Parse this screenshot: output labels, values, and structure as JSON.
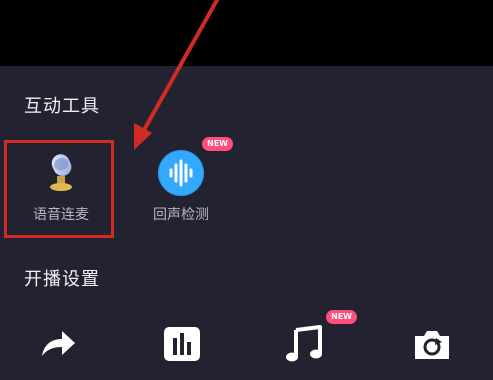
{
  "sections": {
    "interactive_tools_title": "互动工具",
    "live_settings_title": "开播设置"
  },
  "tools": [
    {
      "label": "语音连麦",
      "icon": "microphone-icon"
    },
    {
      "label": "回声检测",
      "icon": "sound-wave-icon",
      "badge": "NEW"
    }
  ],
  "bottom_icons": [
    {
      "icon": "share-arrow-icon"
    },
    {
      "icon": "bar-chart-icon"
    },
    {
      "icon": "music-note-icon",
      "badge": "NEW"
    },
    {
      "icon": "camera-flip-icon"
    }
  ],
  "colors": {
    "panel_bg": "#222230",
    "annotation_red": "#d02b24",
    "badge_pink": "#ff4d7e",
    "echo_blue": "#33a8ff"
  }
}
